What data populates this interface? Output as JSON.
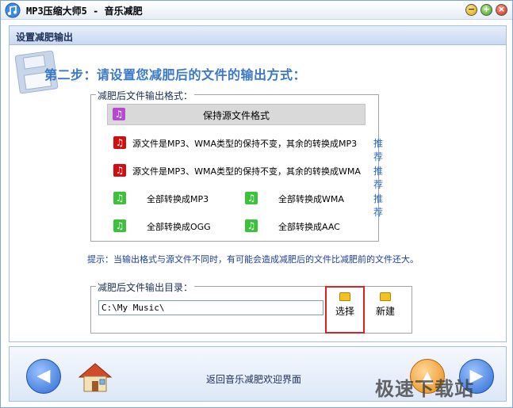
{
  "window": {
    "title": "MP3压缩大师5 - 音乐减肥",
    "min_glyph": "−",
    "max_glyph": "+",
    "close_glyph": "×"
  },
  "panel": {
    "header": "设置减肥输出",
    "step_title": "第二步：请设置您减肥后的文件的输出方式："
  },
  "format_group": {
    "legend": "减肥后文件输出格式：",
    "options": [
      {
        "label": "保持源文件格式",
        "icon": "purple-music-note-icon",
        "recommend": ""
      },
      {
        "label": "源文件是MP3、WMA类型的保持不变，其余的转换成MP3",
        "icon": "red-music-note-icon",
        "recommend": "推荐"
      },
      {
        "label": "源文件是MP3、WMA类型的保持不变，其余的转换成WMA",
        "icon": "red-music-note-icon",
        "recommend": "推荐"
      },
      {
        "label": "全部转换成MP3",
        "icon": "green-music-note-icon",
        "recommend": ""
      },
      {
        "label": "全部转换成WMA",
        "icon": "green-music-note-icon",
        "recommend": "推荐"
      },
      {
        "label": "全部转换成OGG",
        "icon": "green-music-note-icon",
        "recommend": ""
      },
      {
        "label": "全部转换成AAC",
        "icon": "green-music-note-icon",
        "recommend": ""
      }
    ]
  },
  "hint": "提示：当输出格式与源文件不同时，有可能会造成减肥后的文件比减肥前的文件还大。",
  "dir_group": {
    "legend": "减肥后文件输出目录：",
    "path": "C:\\My Music\\",
    "select_label": "选择",
    "new_label": "新建"
  },
  "bottom": {
    "back_text": "返回音乐减肥欢迎界面"
  },
  "watermark": "极速下载站",
  "colors": {
    "accent": "#3a78c8",
    "highlight_border": "#e02020"
  }
}
